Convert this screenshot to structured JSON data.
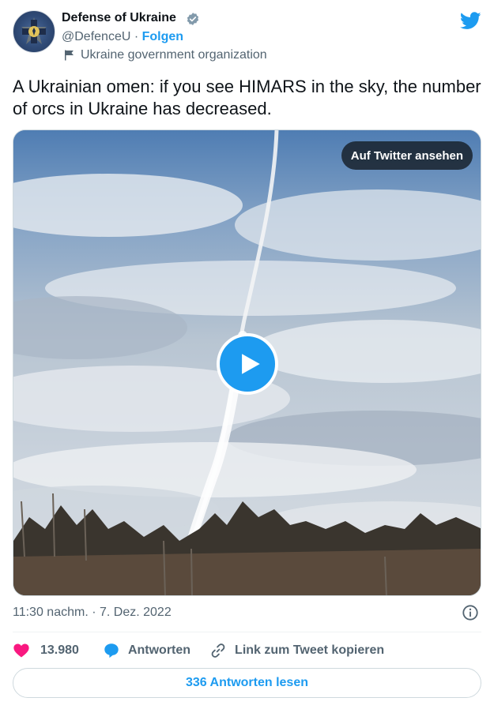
{
  "author": {
    "name": "Defense of Ukraine",
    "handle": "@DefenceU",
    "separator": "·",
    "follow_label": "Folgen",
    "label_text": "Ukraine government organization"
  },
  "tweet": {
    "text": "A Ukrainian omen: if you see HIMARS in the sky, the number of orcs in Ukraine has decreased.",
    "timestamp": "11:30 nachm. · 7. Dez. 2022"
  },
  "media": {
    "view_on_twitter_label": "Auf Twitter ansehen"
  },
  "actions": {
    "like_count": "13.980",
    "reply_label": "Antworten",
    "copy_link_label": "Link zum Tweet kopieren",
    "read_replies_label": "336 Antworten lesen"
  },
  "colors": {
    "accent": "#1d9bf0",
    "like": "#f91880",
    "text": "#0f1419",
    "muted": "#536471"
  },
  "icons": [
    "verified-badge-icon",
    "twitter-bird-icon",
    "flag-icon",
    "play-icon",
    "info-icon",
    "heart-icon",
    "reply-bubble-icon",
    "link-icon"
  ]
}
